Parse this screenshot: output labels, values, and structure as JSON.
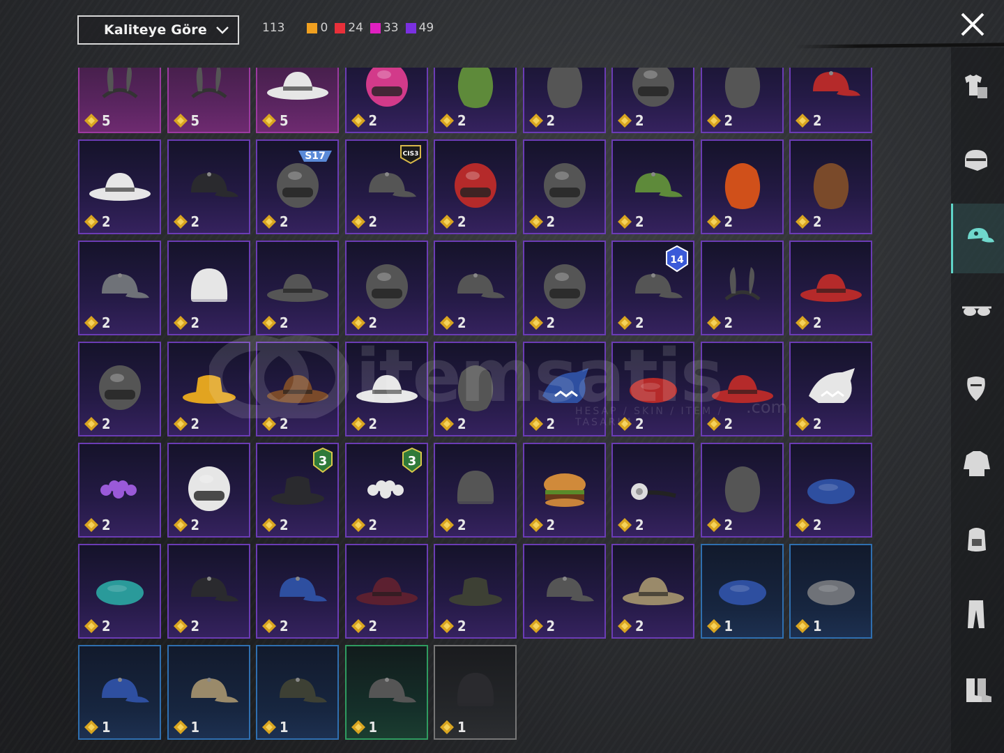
{
  "sort": {
    "label": "Kaliteye Göre"
  },
  "counts": {
    "total": "113",
    "groups": [
      {
        "color": "#f0a020",
        "value": "0"
      },
      {
        "color": "#e8303a",
        "value": "24"
      },
      {
        "color": "#e020c0",
        "value": "33"
      },
      {
        "color": "#7a30e0",
        "value": "49"
      }
    ]
  },
  "watermark": {
    "text": "itemsatis",
    "sub": "HESAP / SKIN / ITEM / TASARIM",
    "domain": ".com"
  },
  "items": [
    {
      "count": "5",
      "rarity": "pink",
      "icon": "headband-horns-icon"
    },
    {
      "count": "5",
      "rarity": "pink",
      "icon": "devil-horns-icon"
    },
    {
      "count": "5",
      "rarity": "pink",
      "icon": "white-sun-hat-icon"
    },
    {
      "count": "2",
      "rarity": "purple",
      "icon": "pink-helmet-icon"
    },
    {
      "count": "2",
      "rarity": "purple",
      "icon": "green-mask-hair-icon"
    },
    {
      "count": "2",
      "rarity": "purple",
      "icon": "gas-mask-helmet-icon"
    },
    {
      "count": "2",
      "rarity": "purple",
      "icon": "tactical-helmet-icon"
    },
    {
      "count": "2",
      "rarity": "purple",
      "icon": "feather-hair-icon"
    },
    {
      "count": "2",
      "rarity": "purple",
      "icon": "red-cap-icon"
    },
    {
      "count": "2",
      "rarity": "purple",
      "icon": "white-wide-hat-icon"
    },
    {
      "count": "2",
      "rarity": "purple",
      "icon": "black-snapback-icon"
    },
    {
      "count": "2",
      "rarity": "purple",
      "icon": "horned-helmet-icon",
      "badge": "S17"
    },
    {
      "count": "2",
      "rarity": "purple",
      "icon": "barrel-hat-icon",
      "badge": "CIS3"
    },
    {
      "count": "2",
      "rarity": "purple",
      "icon": "football-helmet-red-icon"
    },
    {
      "count": "2",
      "rarity": "purple",
      "icon": "cricket-helmet-icon"
    },
    {
      "count": "2",
      "rarity": "purple",
      "icon": "green-cap-icon"
    },
    {
      "count": "2",
      "rarity": "purple",
      "icon": "orange-hair-mask-icon"
    },
    {
      "count": "2",
      "rarity": "purple",
      "icon": "brown-hair-icon"
    },
    {
      "count": "2",
      "rarity": "purple",
      "icon": "gray-cap-icon"
    },
    {
      "count": "2",
      "rarity": "purple",
      "icon": "white-beanie-icon"
    },
    {
      "count": "2",
      "rarity": "purple",
      "icon": "fedora-gold-band-icon"
    },
    {
      "count": "2",
      "rarity": "purple",
      "icon": "goggles-helmet-icon"
    },
    {
      "count": "2",
      "rarity": "purple",
      "icon": "mushroom-hat-icon"
    },
    {
      "count": "2",
      "rarity": "purple",
      "icon": "dark-visor-helmet-icon"
    },
    {
      "count": "2",
      "rarity": "purple",
      "icon": "studded-cap-icon",
      "badge": "14"
    },
    {
      "count": "2",
      "rarity": "purple",
      "icon": "bunny-ears-icon"
    },
    {
      "count": "2",
      "rarity": "purple",
      "icon": "red-feather-hat-icon"
    },
    {
      "count": "2",
      "rarity": "purple",
      "icon": "pith-helmet-icon"
    },
    {
      "count": "2",
      "rarity": "purple",
      "icon": "yellow-bucket-hat-icon"
    },
    {
      "count": "2",
      "rarity": "purple",
      "icon": "brown-cowboy-hat-icon"
    },
    {
      "count": "2",
      "rarity": "purple",
      "icon": "white-feather-hat-icon"
    },
    {
      "count": "2",
      "rarity": "purple",
      "icon": "wrestler-mask-icon"
    },
    {
      "count": "2",
      "rarity": "purple",
      "icon": "blue-shark-hat-icon"
    },
    {
      "count": "2",
      "rarity": "purple",
      "icon": "red-beret-icon"
    },
    {
      "count": "2",
      "rarity": "purple",
      "icon": "red-fedora-icon"
    },
    {
      "count": "2",
      "rarity": "purple",
      "icon": "white-shark-hat-icon"
    },
    {
      "count": "2",
      "rarity": "purple",
      "icon": "purple-flower-crown-icon"
    },
    {
      "count": "2",
      "rarity": "purple",
      "icon": "football-helmet-white-icon"
    },
    {
      "count": "2",
      "rarity": "purple",
      "icon": "black-bucket-hat-icon",
      "badge": "3"
    },
    {
      "count": "2",
      "rarity": "purple",
      "icon": "white-flower-crown-icon",
      "badge": "3"
    },
    {
      "count": "2",
      "rarity": "purple",
      "icon": "cake-hat-icon"
    },
    {
      "count": "2",
      "rarity": "purple",
      "icon": "burger-hat-icon"
    },
    {
      "count": "2",
      "rarity": "purple",
      "icon": "head-mirror-icon"
    },
    {
      "count": "2",
      "rarity": "purple",
      "icon": "paper-bag-icon"
    },
    {
      "count": "2",
      "rarity": "purple",
      "icon": "blue-garrison-cap-icon"
    },
    {
      "count": "2",
      "rarity": "purple",
      "icon": "teal-bandana-icon"
    },
    {
      "count": "2",
      "rarity": "purple",
      "icon": "black-printed-cap-icon"
    },
    {
      "count": "2",
      "rarity": "purple",
      "icon": "blue-trucker-cap-icon"
    },
    {
      "count": "2",
      "rarity": "purple",
      "icon": "maroon-fedora-icon"
    },
    {
      "count": "2",
      "rarity": "purple",
      "icon": "camo-bucket-hat-icon"
    },
    {
      "count": "2",
      "rarity": "purple",
      "icon": "aviator-cap-icon"
    },
    {
      "count": "2",
      "rarity": "purple",
      "icon": "tan-fedora-icon"
    },
    {
      "count": "1",
      "rarity": "blue",
      "icon": "blue-beret-icon"
    },
    {
      "count": "1",
      "rarity": "blue",
      "icon": "gray-beret-icon"
    },
    {
      "count": "1",
      "rarity": "blue",
      "icon": "red-blue-cap-icon"
    },
    {
      "count": "1",
      "rarity": "blue",
      "icon": "tan-blue-cap-icon"
    },
    {
      "count": "1",
      "rarity": "blue",
      "icon": "camo-patrol-cap-icon"
    },
    {
      "count": "1",
      "rarity": "green",
      "icon": "flag-patrol-cap-icon"
    },
    {
      "count": "1",
      "rarity": "gray",
      "icon": "black-beanie-icon"
    }
  ],
  "sidebar": [
    {
      "icon": "outfit-icon",
      "active": false
    },
    {
      "icon": "face-helmet-icon",
      "active": false
    },
    {
      "icon": "cap-icon",
      "active": true
    },
    {
      "icon": "glasses-icon",
      "active": false
    },
    {
      "icon": "mask-icon",
      "active": false
    },
    {
      "icon": "jacket-icon",
      "active": false
    },
    {
      "icon": "backpack-icon",
      "active": false
    },
    {
      "icon": "pants-icon",
      "active": false
    },
    {
      "icon": "boots-icon",
      "active": false
    }
  ]
}
